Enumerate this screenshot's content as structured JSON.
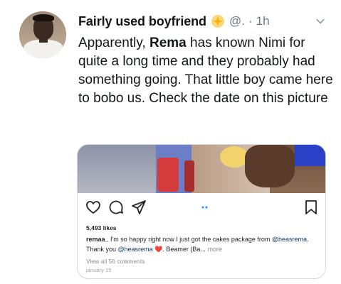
{
  "tweet": {
    "display_name": "Fairly used boyfriend",
    "handle": "@.",
    "separator": "·",
    "time": "1h",
    "text_before": "Apparently, ",
    "text_bold": "Rema",
    "text_after": " has known Nimi for quite a long time and they probably had something going. That little boy came here to bobo us. Check the date on this picture"
  },
  "embed": {
    "likes": "5,493 likes",
    "caption_user": "remaa_",
    "caption_text_1": " I'm so happy right now I just got the cakes package from ",
    "caption_mention_1": "@heasrema",
    "caption_text_2": ". Thank you ",
    "caption_mention_2": "@heasrema",
    "caption_heart": " ❤️. Beamer (Ba...",
    "caption_more": "more",
    "comments": "View all 56 comments",
    "date": "january 15"
  },
  "colors": {
    "text": "#14171a",
    "secondary": "#657786",
    "border": "#cfd9de",
    "badge": "#f5b301",
    "dot_blue": "#3897f0"
  },
  "icons": [
    "chevron-down-icon",
    "sparkle-badge-icon",
    "heart-icon",
    "comment-icon",
    "send-icon",
    "bookmark-icon",
    "carousel-dots-icon"
  ]
}
